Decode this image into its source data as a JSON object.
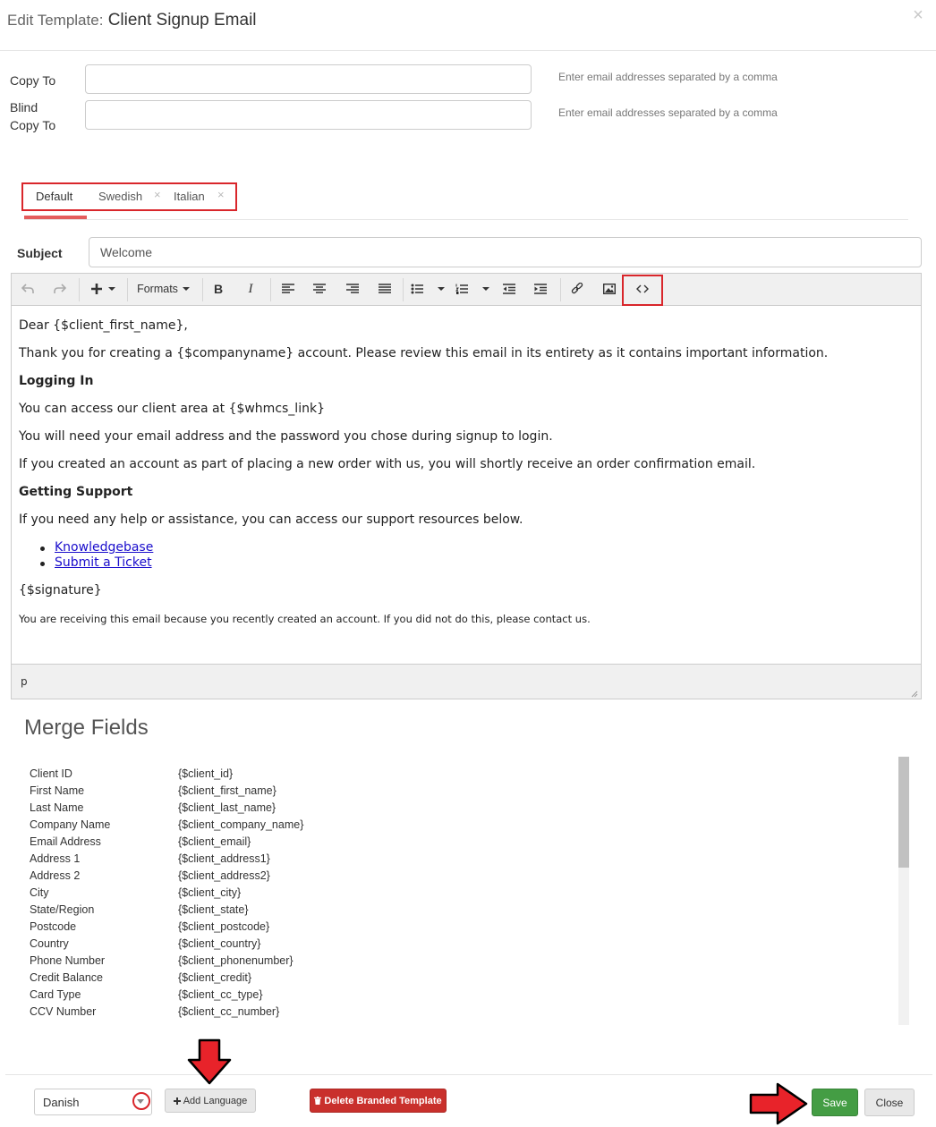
{
  "header": {
    "title_prefix": "Edit Template:",
    "title": "Client Signup Email",
    "close_icon": "×"
  },
  "recipients": {
    "copy_to_label": "Copy To",
    "bcc_label_line1": "Blind",
    "bcc_label_line2": "Copy To",
    "copy_to_value": "",
    "bcc_value": "",
    "hint": "Enter email addresses separated by a comma"
  },
  "language_tabs": [
    {
      "label": "Default",
      "active": true
    },
    {
      "label": "Swedish",
      "closable": true
    },
    {
      "label": "Italian",
      "closable": true
    }
  ],
  "tab_close_icon": "×",
  "subject": {
    "label": "Subject",
    "value": "Welcome"
  },
  "toolbar": {
    "formats_label": "Formats",
    "buttons": [
      "undo-icon",
      "redo-icon",
      "insert-icon",
      "bold-icon",
      "italic-icon",
      "align-left-icon",
      "align-center-icon",
      "align-right-icon",
      "justify-icon",
      "bullet-list-icon",
      "numbered-list-icon",
      "outdent-icon",
      "indent-icon",
      "link-icon",
      "image-icon",
      "source-code-icon"
    ]
  },
  "editor": {
    "greeting": "Dear {$client_first_name},",
    "intro": "Thank you for creating a {$companyname} account. Please review this email in its entirety as it contains important information.",
    "heading1": "Logging In",
    "p1": "You can access our client area at {$whmcs_link}",
    "p2": "You will need your email address and the password you chose during signup to login.",
    "p3": "If you created an account as part of placing a new order with us, you will shortly receive an order confirmation email.",
    "heading2": "Getting Support",
    "p4": "If you need any help or assistance, you can access our support resources below.",
    "links": [
      "Knowledgebase",
      "Submit a Ticket"
    ],
    "signature": "{$signature}",
    "footer_note": "You are receiving this email because you recently created an account. If you did not do this, please contact us."
  },
  "statusbar": {
    "path": "p"
  },
  "merge_fields": {
    "title": "Merge Fields",
    "rows": [
      [
        "Client ID",
        "{$client_id}"
      ],
      [
        "First Name",
        "{$client_first_name}"
      ],
      [
        "Last Name",
        "{$client_last_name}"
      ],
      [
        "Company Name",
        "{$client_company_name}"
      ],
      [
        "Email Address",
        "{$client_email}"
      ],
      [
        "Address 1",
        "{$client_address1}"
      ],
      [
        "Address 2",
        "{$client_address2}"
      ],
      [
        "City",
        "{$client_city}"
      ],
      [
        "State/Region",
        "{$client_state}"
      ],
      [
        "Postcode",
        "{$client_postcode}"
      ],
      [
        "Country",
        "{$client_country}"
      ],
      [
        "Phone Number",
        "{$client_phonenumber}"
      ],
      [
        "Credit Balance",
        "{$client_credit}"
      ],
      [
        "Card Type",
        "{$client_cc_type}"
      ],
      [
        "CCV Number",
        "{$client_cc_number}"
      ]
    ]
  },
  "footer": {
    "language_select": "Danish",
    "add_language": "Add Language",
    "delete_branded": "Delete Branded Template",
    "save": "Save",
    "close": "Close"
  },
  "colors": {
    "annotation_red": "#d9262b",
    "save_green": "#449d44",
    "delete_red": "#c9302c",
    "link_blue": "#1a0dcc"
  }
}
